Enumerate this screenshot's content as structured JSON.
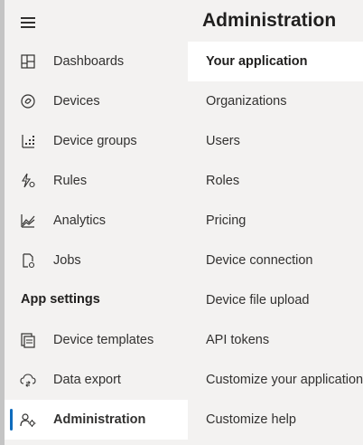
{
  "sidebar": {
    "menu_icon": "hamburger-icon",
    "section_heading": "App settings",
    "items": [
      {
        "label": "Dashboards",
        "icon": "dashboard-icon"
      },
      {
        "label": "Devices",
        "icon": "device-icon"
      },
      {
        "label": "Device groups",
        "icon": "device-groups-icon"
      },
      {
        "label": "Rules",
        "icon": "rules-icon"
      },
      {
        "label": "Analytics",
        "icon": "analytics-icon"
      },
      {
        "label": "Jobs",
        "icon": "jobs-icon"
      },
      {
        "label": "Device templates",
        "icon": "device-templates-icon"
      },
      {
        "label": "Data export",
        "icon": "data-export-icon"
      },
      {
        "label": "Administration",
        "icon": "administration-icon",
        "active": true
      }
    ]
  },
  "main": {
    "title": "Administration",
    "items": [
      {
        "label": "Your application",
        "selected": true
      },
      {
        "label": "Organizations"
      },
      {
        "label": "Users"
      },
      {
        "label": "Roles"
      },
      {
        "label": "Pricing"
      },
      {
        "label": "Device connection"
      },
      {
        "label": "Device file upload"
      },
      {
        "label": "API tokens"
      },
      {
        "label": "Customize your application"
      },
      {
        "label": "Customize help"
      }
    ]
  },
  "colors": {
    "sidebar_bg": "#f3f2f1",
    "active_bg": "#ffffff",
    "accent": "#0f6cbd",
    "text": "#323130"
  }
}
